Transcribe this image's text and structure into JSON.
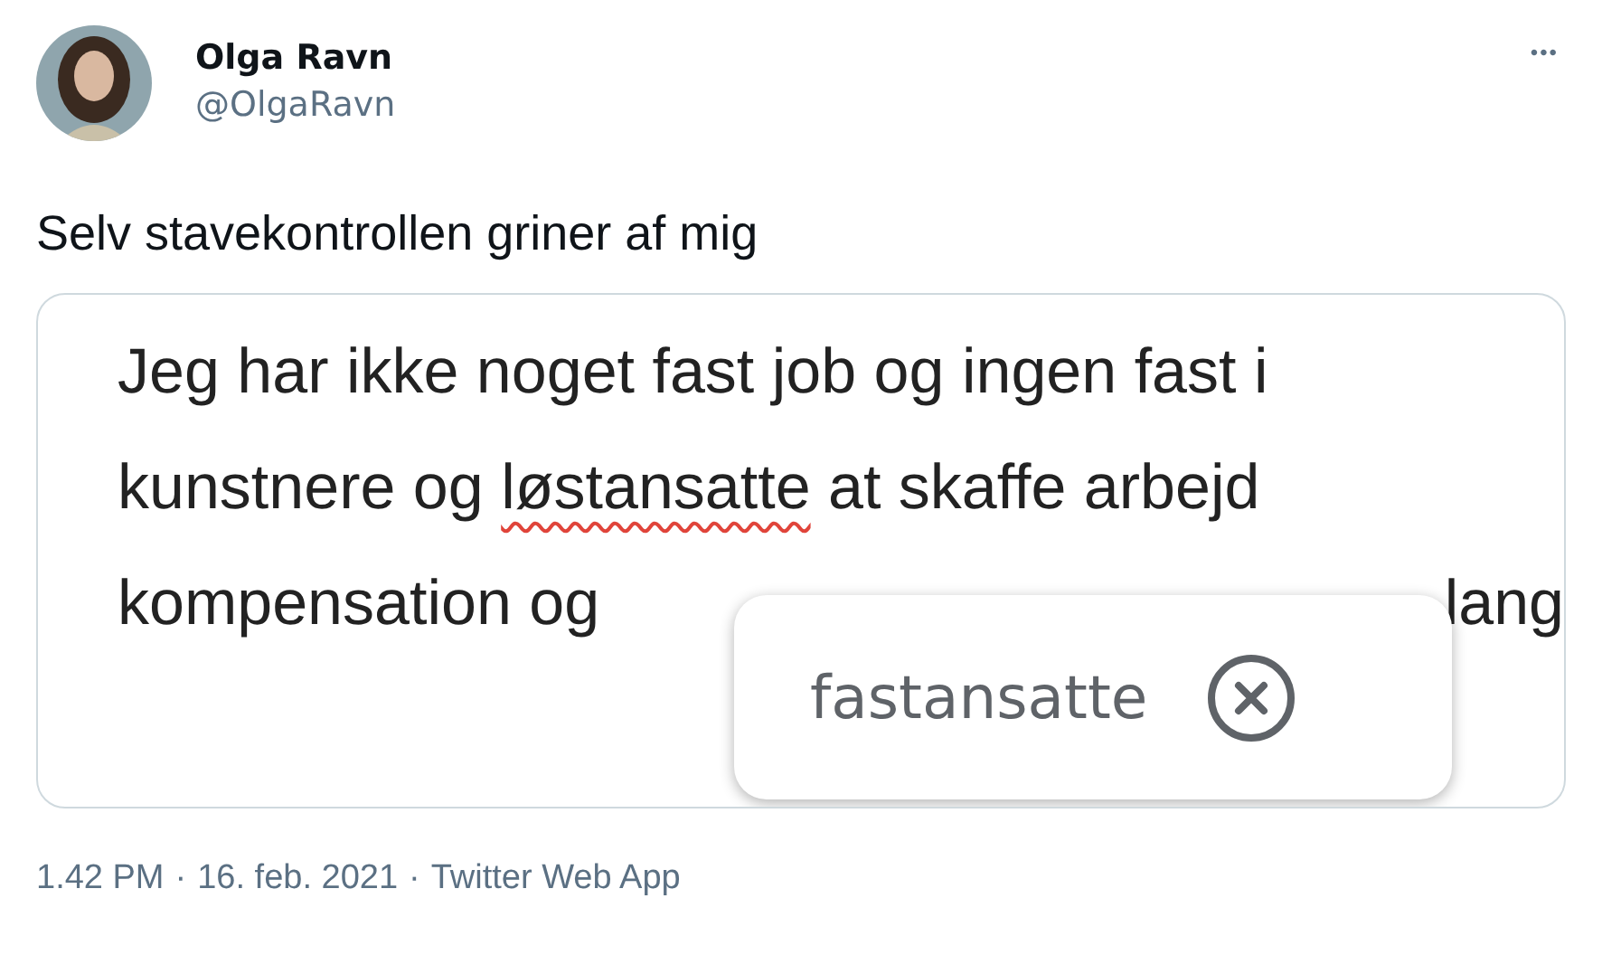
{
  "author": {
    "name": "Olga Ravn",
    "handle": "@OlgaRavn"
  },
  "more_menu": "•••",
  "tweet_text": "Selv stavekontrollen griner af mig",
  "media": {
    "lines": [
      {
        "segments": [
          {
            "text": "Jeg har ikke noget fast job og ingen fast i",
            "misspelled": false
          }
        ]
      },
      {
        "segments": [
          {
            "text": "kunstnere og ",
            "misspelled": false
          },
          {
            "text": "løstansatte",
            "misspelled": true
          },
          {
            "text": " at skaffe arbejd",
            "misspelled": false
          }
        ]
      },
      {
        "segments": [
          {
            "text": "kompensation og",
            "misspelled": false
          }
        ],
        "tail": "lang"
      }
    ],
    "suggestion": {
      "text": "fastansatte"
    }
  },
  "footer": {
    "time": "1.42 PM",
    "date": "16. feb. 2021",
    "source": "Twitter Web App",
    "separator": "·"
  }
}
